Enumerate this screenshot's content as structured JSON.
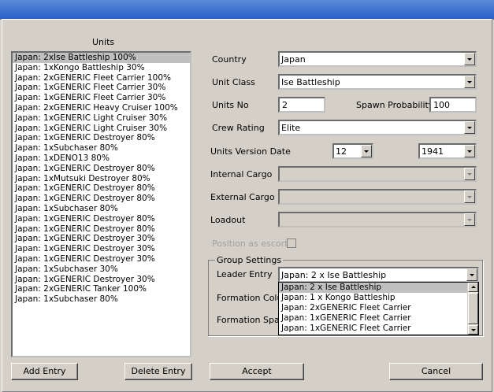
{
  "units_title": "Units",
  "units": [
    "Japan: 2xIse Battleship 100%",
    "Japan: 1xKongo Battleship 30%",
    "Japan: 2xGENERIC Fleet Carrier 100%",
    "Japan: 1xGENERIC Fleet Carrier 30%",
    "Japan: 1xGENERIC Fleet Carrier 30%",
    "Japan: 2xGENERIC Heavy Cruiser 100%",
    "Japan: 1xGENERIC Light Cruiser 30%",
    "Japan: 1xGENERIC Light Cruiser 30%",
    "Japan: 1xGENERIC Destroyer 80%",
    "Japan: 1xSubchaser 80%",
    "Japan: 1xDENO13 80%",
    "Japan: 1xGENERIC Destroyer 80%",
    "Japan: 1xMutsuki Destroyer 80%",
    "Japan: 1xGENERIC Destroyer 80%",
    "Japan: 1xGENERIC Destroyer 80%",
    "Japan: 1xSubchaser 80%",
    "Japan: 1xGENERIC Destroyer 80%",
    "Japan: 1xGENERIC Destroyer 80%",
    "Japan: 1xGENERIC Destroyer 30%",
    "Japan: 1xGENERIC Destroyer 30%",
    "Japan: 1xGENERIC Destroyer 30%",
    "Japan: 1xSubchaser 30%",
    "Japan: 1xGENERIC Destroyer 30%",
    "Japan: 2xGENERIC Tanker 100%",
    "Japan: 1xSubchaser 80%"
  ],
  "fields": {
    "country_label": "Country",
    "country_value": "Japan",
    "unit_class_label": "Unit Class",
    "unit_class_value": "Ise Battleship",
    "units_no_label": "Units No",
    "units_no_value": "2",
    "spawn_label": "Spawn Probability",
    "spawn_value": "100",
    "crew_label": "Crew Rating",
    "crew_value": "Elite",
    "version_label": "Units Version Date",
    "version_month": "12",
    "version_year": "1941",
    "internal_cargo_label": "Internal Cargo",
    "external_cargo_label": "External Cargo",
    "loadout_label": "Loadout",
    "position_escort_label": "Position as escort"
  },
  "group": {
    "title": "Group Settings",
    "leader_label": "Leader Entry",
    "leader_value": "Japan: 2 x Ise Battleship",
    "formation_column_label": "Formation Colum",
    "formation_spacing_label": "Formation Spaci",
    "dropdown_options": [
      "Japan: 2 x Ise Battleship",
      "Japan: 1 x Kongo Battleship",
      "Japan: 2xGENERIC Fleet Carrier",
      "Japan: 1xGENERIC Fleet Carrier",
      "Japan: 1xGENERIC Fleet Carrier"
    ]
  },
  "buttons": {
    "add": "Add Entry",
    "delete": "Delete Entry",
    "accept": "Accept",
    "cancel": "Cancel"
  }
}
